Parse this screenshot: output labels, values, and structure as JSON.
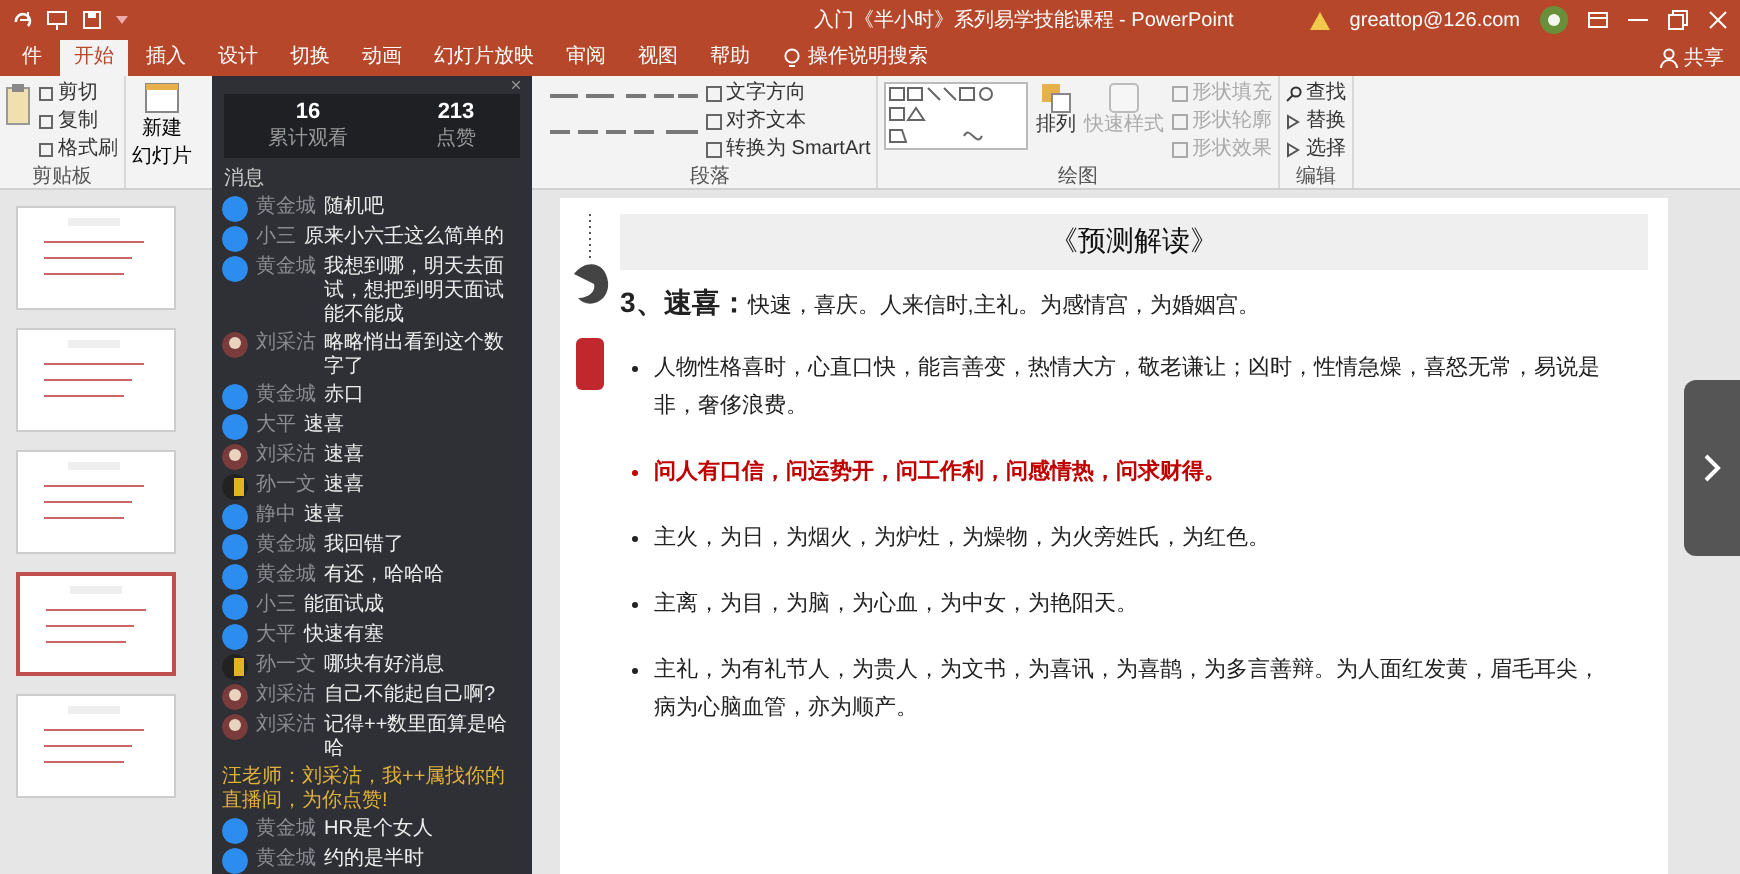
{
  "window": {
    "title": "入门《半小时》系列易学技能课程 - PowerPoint",
    "account": "greattop@126.com",
    "share": "共享"
  },
  "ribbon_tabs": [
    {
      "label": "件",
      "selected": false
    },
    {
      "label": "开始",
      "selected": true
    },
    {
      "label": "插入",
      "selected": false
    },
    {
      "label": "设计",
      "selected": false
    },
    {
      "label": "切换",
      "selected": false
    },
    {
      "label": "动画",
      "selected": false
    },
    {
      "label": "幻灯片放映",
      "selected": false
    },
    {
      "label": "审阅",
      "selected": false
    },
    {
      "label": "视图",
      "selected": false
    },
    {
      "label": "帮助",
      "selected": false
    }
  ],
  "tell_me": "操作说明搜索",
  "clipboard": {
    "label": "剪贴板",
    "items": [
      "剪切",
      "复制",
      "格式刷"
    ]
  },
  "new_slide": {
    "lines": [
      "新建",
      "幻灯片"
    ]
  },
  "paragraph": {
    "label": "段落",
    "items": [
      "文字方向",
      "对齐文本",
      "转换为 SmartArt"
    ]
  },
  "drawing": {
    "label": "绘图",
    "arrange": "排列",
    "quick_styles": {
      "label": "快速样式",
      "disabled": true
    },
    "items": [
      {
        "label": "形状填充",
        "disabled": true
      },
      {
        "label": "形状轮廓",
        "disabled": true
      },
      {
        "label": "形状效果",
        "disabled": true
      }
    ]
  },
  "editing": {
    "label": "编辑",
    "items": [
      "查找",
      "替换",
      "选择"
    ]
  },
  "thumbnails": [
    {
      "selected": false
    },
    {
      "selected": false
    },
    {
      "selected": false
    },
    {
      "selected": true
    },
    {
      "selected": false
    }
  ],
  "chat": {
    "stats": [
      {
        "value": "16",
        "label": "累计观看"
      },
      {
        "value": "213",
        "label": "点赞"
      }
    ],
    "header": "消息",
    "messages": [
      {
        "kind": "badge",
        "name": "黄金城",
        "text": "随机吧"
      },
      {
        "kind": "badge",
        "name": "小三",
        "text": "原来小六壬这么简单的"
      },
      {
        "kind": "badge",
        "name": "黄金城",
        "text": "我想到哪，明天去面试，想把到明天面试能不能成"
      },
      {
        "kind": "photo",
        "name": "刘采沽",
        "text": "略略悄出看到这个数字了"
      },
      {
        "kind": "badge",
        "name": "黄金城",
        "text": "赤口"
      },
      {
        "kind": "badge",
        "name": "大平",
        "text": "速喜"
      },
      {
        "kind": "photo",
        "name": "刘采沽",
        "text": "速喜"
      },
      {
        "kind": "art",
        "name": "孙一文",
        "text": "速喜"
      },
      {
        "kind": "badge",
        "name": "静中",
        "text": "速喜"
      },
      {
        "kind": "badge",
        "name": "黄金城",
        "text": "我回错了"
      },
      {
        "kind": "badge",
        "name": "黄金城",
        "text": "有还，哈哈哈"
      },
      {
        "kind": "badge",
        "name": "小三",
        "text": "能面试成"
      },
      {
        "kind": "badge",
        "name": "大平",
        "text": "快速有塞"
      },
      {
        "kind": "art",
        "name": "孙一文",
        "text": "哪块有好消息"
      },
      {
        "kind": "photo",
        "name": "刘采沽",
        "text": "自己不能起自己啊?"
      },
      {
        "kind": "photo",
        "name": "刘采沽",
        "text": "记得++数里面算是哈哈"
      },
      {
        "kind": "system",
        "text": "汪老师：刘采沽，我++属找你的直播间，为你点赞!"
      },
      {
        "kind": "badge",
        "name": "黄金城",
        "text": "HR是个女人"
      },
      {
        "kind": "badge",
        "name": "黄金城",
        "text": "约的是半时"
      }
    ]
  },
  "slide": {
    "title": "《预测解读》",
    "heading": {
      "label": "3、速喜：",
      "text": "快速，喜庆。人来信时,主礼。为感情宫，为婚姻宫。"
    },
    "bullets": [
      {
        "text": "人物性格喜时，心直口快，能言善变，热情大方，敬老谦让；凶时，性情急燥，喜怒无常，易说是非，奢侈浪费。",
        "emphasis": false
      },
      {
        "text": "问人有口信，问运势开，问工作利，问感情热，问求财得。",
        "emphasis": true
      },
      {
        "text": "主火，为日，为烟火，为炉灶，为燥物，为火旁姓氏，为红色。",
        "emphasis": false
      },
      {
        "text": "主离，为目，为脑，为心血，为中女，为艳阳天。",
        "emphasis": false
      },
      {
        "text": "主礼，为有礼节人，为贵人，为文书，为喜讯，为喜鹊，为多言善辩。为人面红发黄，眉毛耳尖，病为心脑血管，亦为顺产。",
        "emphasis": false
      }
    ]
  }
}
